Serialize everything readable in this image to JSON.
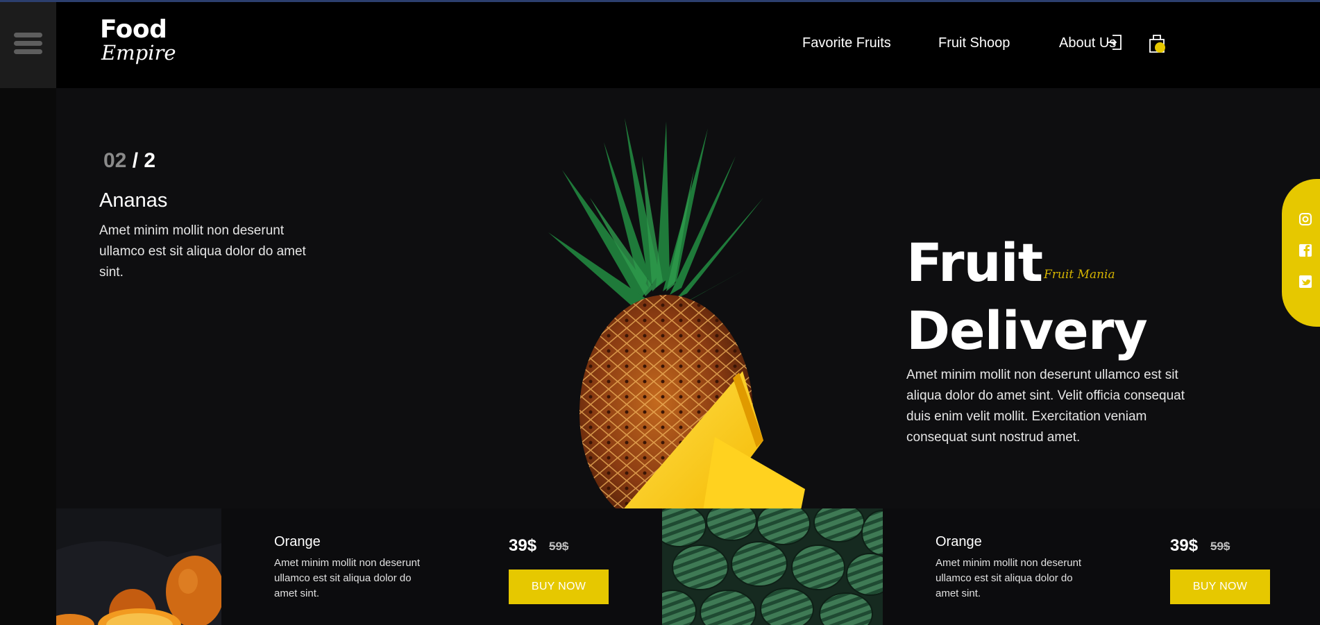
{
  "app": {
    "logo": {
      "line1": "Food",
      "line2": "Empire"
    }
  },
  "nav": {
    "items": [
      {
        "label": "Favorite Fruits"
      },
      {
        "label": "Fruit Shoop"
      },
      {
        "label": "About Us"
      }
    ],
    "icons": [
      "login-icon",
      "cart-icon"
    ]
  },
  "hero": {
    "counter": {
      "current": "02",
      "separator": " / ",
      "total": "2"
    },
    "slide_title": "Ananas",
    "slide_description": "Amet minim mollit non deserunt ullamco est sit aliqua dolor do amet sint.",
    "headline_line1": "Fruit",
    "headline_line2": "Delivery",
    "tagline": "Fruit Mania",
    "description": "Amet minim mollit non deserunt ullamco est sit aliqua dolor do amet sint. Velit officia consequat duis enim velit mollit. Exercitation veniam consequat sunt nostrud amet."
  },
  "social": [
    "instagram-icon",
    "facebook-icon",
    "twitter-icon"
  ],
  "products": [
    {
      "name": "Orange",
      "description": "Amet minim mollit non deserunt ullamco est sit aliqua dolor do amet sint.",
      "price": "39$",
      "old_price": "59$",
      "button": "BUY NOW",
      "image": "orange-image"
    },
    {
      "name": "Orange",
      "description": "Amet minim mollit non deserunt ullamco est sit aliqua dolor do amet sint.",
      "price": "39$",
      "old_price": "59$",
      "button": "BUY NOW",
      "image": "watermelon-image"
    }
  ],
  "colors": {
    "accent": "#e6c800",
    "background": "#0e0e10",
    "header": "#000000",
    "tagline": "#d4b300"
  }
}
